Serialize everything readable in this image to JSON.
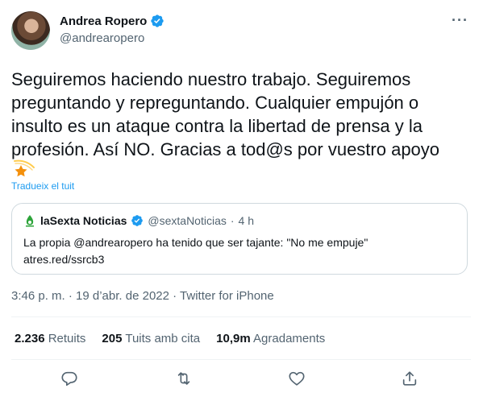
{
  "author": {
    "name": "Andrea Ropero",
    "handle": "@andrearopero"
  },
  "tweet": {
    "text": "Seguiremos haciendo nuestro trabajo. Seguiremos preguntando y repreguntando. Cualquier empujón o insulto es un ataque contra la libertad de prensa y la profesión. Así NO. Gracias a tod@s por vuestro apoyo",
    "translate_label": "Tradueix el tuit"
  },
  "quote": {
    "name": "laSexta Noticias",
    "handle": "@sextaNoticias",
    "separator": "·",
    "time": "4 h",
    "line1": "La propia @andrearopero  ha tenido que ser tajante: \"No me empuje\"",
    "line2": "atres.red/ssrcb3"
  },
  "timestamp": "3:46 p. m. · 19 d’abr. de 2022 · Twitter for iPhone",
  "stats": [
    {
      "value": "2.236",
      "label": "Retuits"
    },
    {
      "value": "205",
      "label": "Tuits amb cita"
    },
    {
      "value": "10,9m",
      "label": "Agradaments"
    }
  ],
  "more_label": "···",
  "icons": {
    "verified": "verified-badge-icon",
    "reply": "reply-icon",
    "retweet": "retweet-icon",
    "like": "like-icon",
    "share": "share-icon",
    "star": "shooting-star-emoji"
  },
  "colors": {
    "accent": "#1d9bf0",
    "text": "#0f1419",
    "secondary": "#536471",
    "border": "#cfd9de",
    "lasexta_green": "#2da43a"
  }
}
